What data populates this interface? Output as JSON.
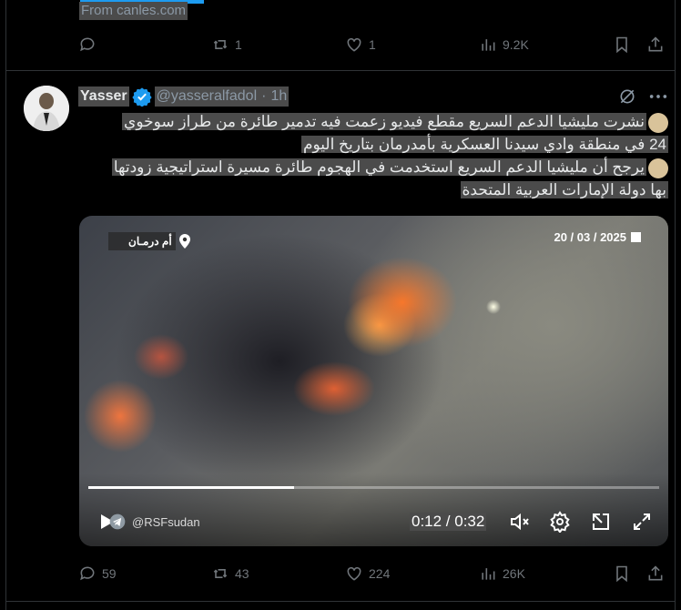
{
  "prev_tweet": {
    "source_text": "From canles.com",
    "stats": {
      "replies": "",
      "reposts": "1",
      "likes": "1",
      "views": "9.2K"
    }
  },
  "tweet": {
    "author_name": "Yasser",
    "handle": "@yasseralfadol",
    "separator": "·",
    "time": "1h",
    "text_line1": "نشرت مليشيا الدعم السريع مقطع فيديو زعمت فيه تدمير طائرة من طراز سوخوي",
    "text_line2": "24 في منطقة وادي سيدنا العسكرية بأمدرمان بتاريخ اليوم",
    "text_line3": "يرجح أن مليشيا الدعم السريع استخدمت في الهجوم طائرة مسيرة استراتيجية زودتها",
    "text_line4": "بها دولة الإمارات العربية المتحدة",
    "video": {
      "location_label": "أم درمـان",
      "date_label": "20 / 03 / 2025",
      "watermark": "@RSFsudan",
      "time_display": "0:12 / 0:32",
      "progress": 0.36
    },
    "stats": {
      "replies": "59",
      "reposts": "43",
      "likes": "224",
      "views": "26K"
    }
  },
  "colors": {
    "accent": "#1d9bf0",
    "muted": "#71767b",
    "selection": "#4b4b4b"
  }
}
